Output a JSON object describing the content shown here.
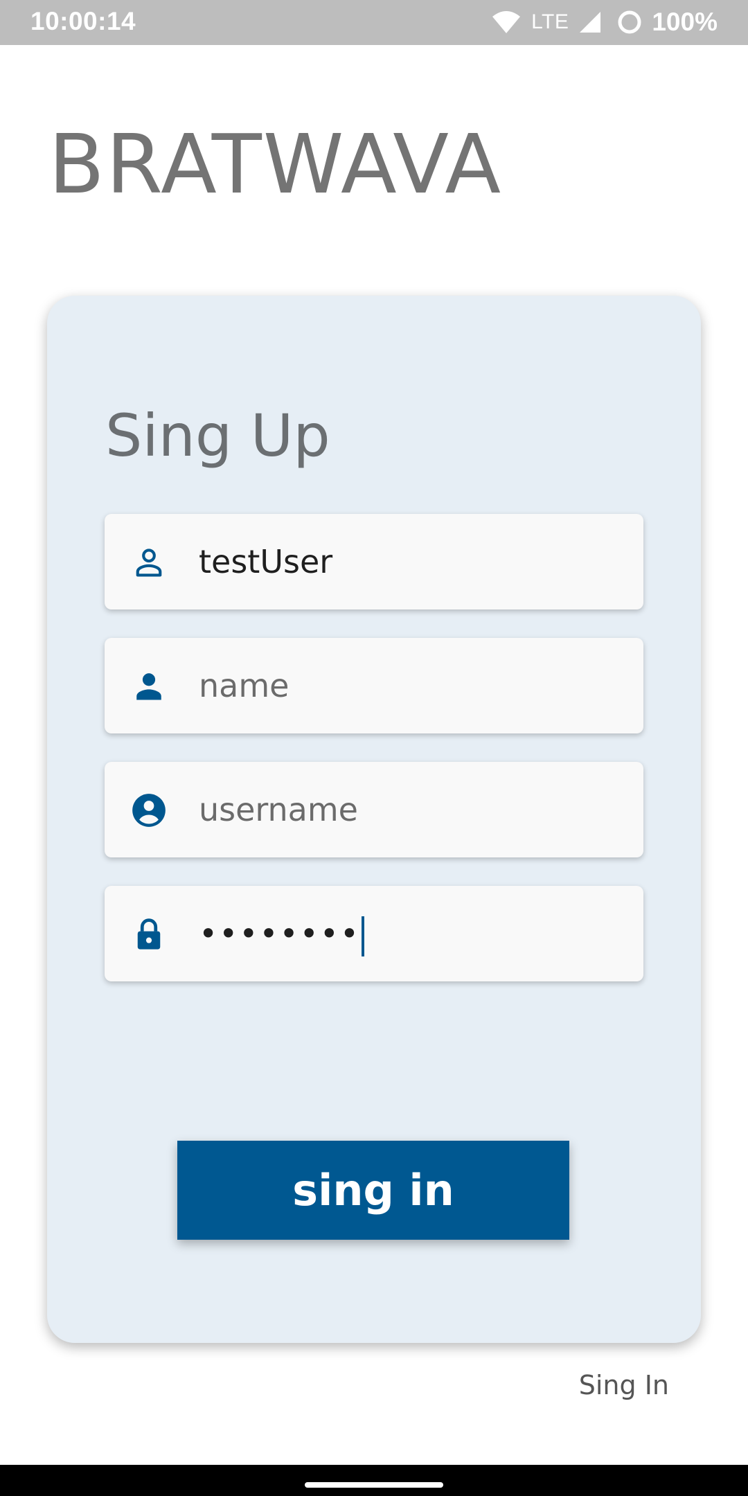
{
  "status_bar": {
    "time": "10:00:14",
    "network": "LTE",
    "battery": "100%"
  },
  "app": {
    "title": "BRATWAVA"
  },
  "form": {
    "title": "Sing Up",
    "fields": [
      {
        "icon": "person-outline-icon",
        "value": "testUser",
        "placeholder": ""
      },
      {
        "icon": "person-icon",
        "value": "",
        "placeholder": "name"
      },
      {
        "icon": "account-circle-icon",
        "value": "",
        "placeholder": "username"
      },
      {
        "icon": "lock-icon",
        "value": "••••••••",
        "placeholder": ""
      }
    ],
    "submit_label": "sing in"
  },
  "footer": {
    "link_label": "Sing In"
  },
  "colors": {
    "accent": "#005891",
    "card_background": "#e6eef5",
    "field_background": "#f9f9f9",
    "status_bar": "#bdbdbd"
  }
}
